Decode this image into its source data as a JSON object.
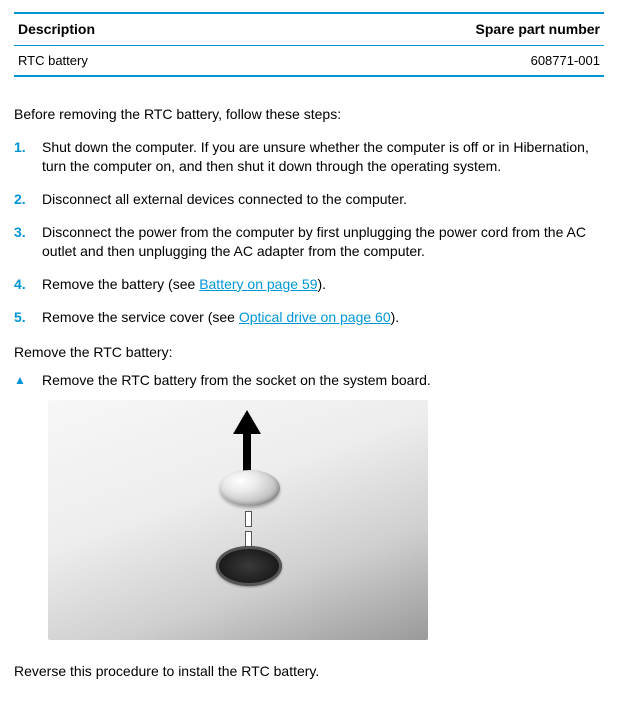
{
  "table": {
    "headers": {
      "description": "Description",
      "spare": "Spare part number"
    },
    "rows": [
      {
        "description": "RTC battery",
        "spare": "608771-001"
      }
    ]
  },
  "intro": "Before removing the RTC battery, follow these steps:",
  "steps": [
    {
      "text": "Shut down the computer. If you are unsure whether the computer is off or in Hibernation, turn the computer on, and then shut it down through the operating system."
    },
    {
      "text": "Disconnect all external devices connected to the computer."
    },
    {
      "text": "Disconnect the power from the computer by first unplugging the power cord from the AC outlet and then unplugging the AC adapter from the computer."
    },
    {
      "before": "Remove the battery (see ",
      "link": "Battery on page 59",
      "after": ")."
    },
    {
      "before": "Remove the service cover (see ",
      "link": "Optical drive on page 60",
      "after": ")."
    }
  ],
  "subhead": "Remove the RTC battery:",
  "bullet": "Remove the RTC battery from the socket on the system board.",
  "closing": "Reverse this procedure to install the RTC battery."
}
